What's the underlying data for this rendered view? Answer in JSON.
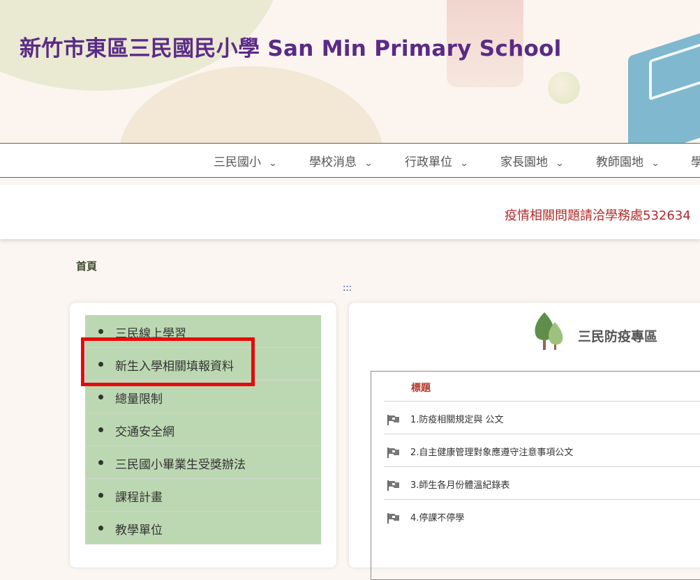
{
  "site": {
    "title": "新竹市東區三民國民小學 San Min Primary School"
  },
  "nav": {
    "items": [
      {
        "label": "三民國小"
      },
      {
        "label": "學校消息"
      },
      {
        "label": "行政單位"
      },
      {
        "label": "家長園地"
      },
      {
        "label": "教師園地"
      },
      {
        "label": "學"
      }
    ],
    "chevron": "⌄"
  },
  "marquee": {
    "text": "疫情相關問題請洽學務處532634"
  },
  "breadcrumb": {
    "home": "首頁"
  },
  "accesskey": ":::",
  "left_menu": {
    "items": [
      {
        "label": "三民線上學習"
      },
      {
        "label": "新生入學相關填報資料"
      },
      {
        "label": "總量限制"
      },
      {
        "label": "交通安全網"
      },
      {
        "label": "三民國小畢業生受獎辦法"
      },
      {
        "label": "課程計畫"
      },
      {
        "label": "教學單位"
      }
    ]
  },
  "section": {
    "title": "三民防疫專區",
    "table_header": "標題",
    "rows": [
      {
        "label": "1.防疫相關規定與 公文"
      },
      {
        "label": "2.自主健康管理對象應遵守注意事項公文"
      },
      {
        "label": "3.師生各月份體溫紀錄表"
      },
      {
        "label": "4.停課不停學"
      }
    ]
  },
  "colors": {
    "title": "#5a2a87",
    "menu_bg": "#bcd8b2",
    "highlight": "#e8090b",
    "marquee_text": "#b22a2a"
  }
}
